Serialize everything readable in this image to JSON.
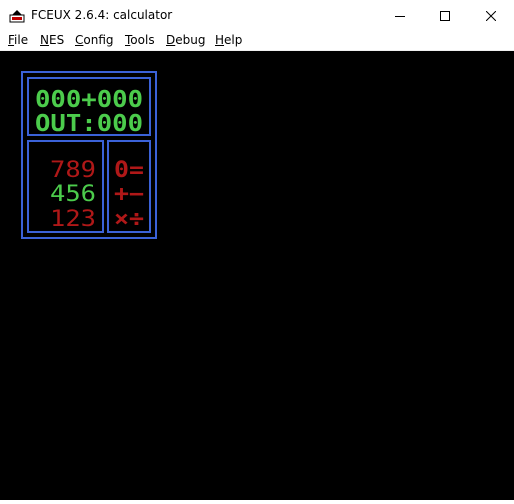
{
  "window": {
    "title": "FCEUX 2.6.4: calculator",
    "controls": [
      "minimize-icon",
      "maximize-icon",
      "close-icon"
    ]
  },
  "menu": {
    "items": [
      {
        "label": "File",
        "accel": "F",
        "rest": "ile"
      },
      {
        "label": "NES",
        "accel": "N",
        "rest": "ES"
      },
      {
        "label": "Config",
        "accel": "C",
        "rest": "onfig"
      },
      {
        "label": "Tools",
        "accel": "T",
        "rest": "ools"
      },
      {
        "label": "Debug",
        "accel": "D",
        "rest": "ebug"
      },
      {
        "label": "Help",
        "accel": "H",
        "rest": "elp"
      }
    ]
  },
  "calculator": {
    "display": {
      "line1": "000+000",
      "line2": "OUT:000"
    },
    "keypad": {
      "row1": "789",
      "row2": "456",
      "row3": "123"
    },
    "operators": {
      "row1": "0=",
      "row2": "+−",
      "row3": "×÷"
    },
    "colors": {
      "border": "#3b62d8",
      "green": "#4ccc4c",
      "red": "#b01818",
      "background": "#000000"
    }
  }
}
